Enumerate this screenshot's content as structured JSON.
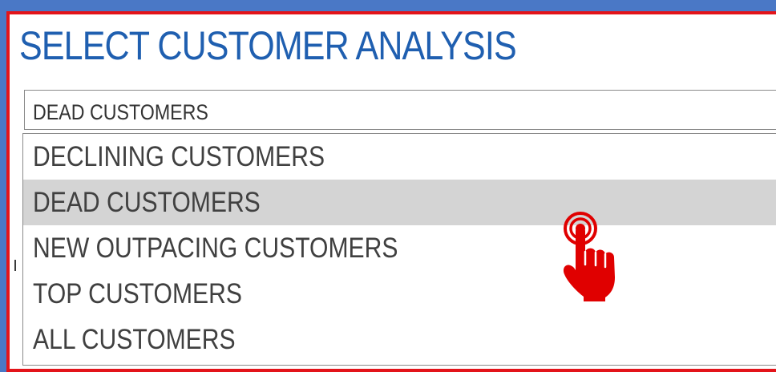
{
  "panel": {
    "title": "SELECT CUSTOMER ANALYSIS"
  },
  "select": {
    "current_value": "DEAD CUSTOMERS"
  },
  "dropdown": {
    "options": [
      {
        "label": "DECLINING CUSTOMERS",
        "highlighted": false
      },
      {
        "label": "DEAD CUSTOMERS",
        "highlighted": true
      },
      {
        "label": "NEW OUTPACING CUSTOMERS",
        "highlighted": false
      },
      {
        "label": "TOP CUSTOMERS",
        "highlighted": false
      },
      {
        "label": "ALL CUSTOMERS",
        "highlighted": false
      }
    ]
  },
  "cursor": {
    "icon": "pointing-hand-cursor-icon",
    "color": "#e00000"
  },
  "colors": {
    "background": "#4a78c6",
    "panel_border": "#e3141a",
    "title": "#1f5fb0",
    "highlight": "#d4d4d4"
  }
}
